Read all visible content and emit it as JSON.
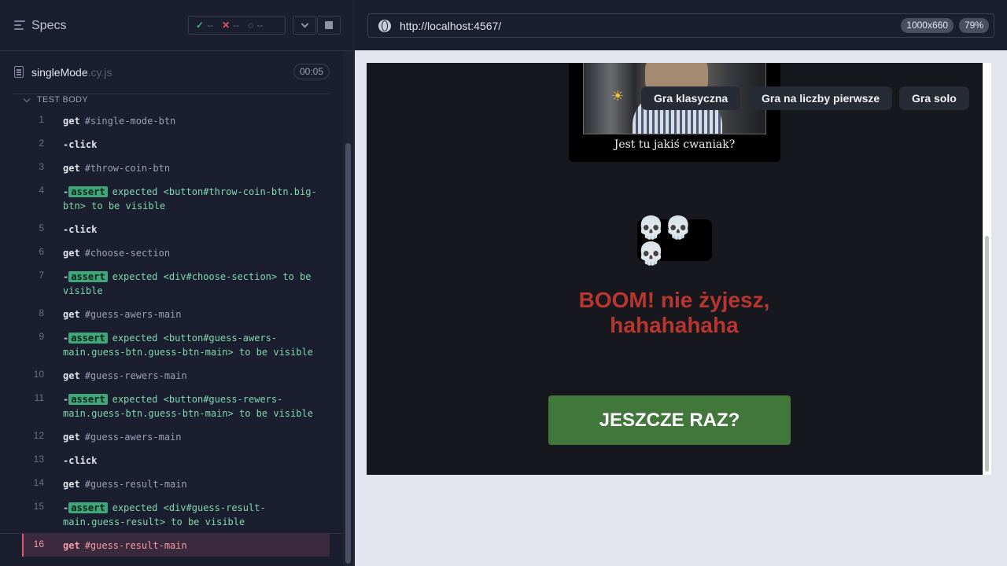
{
  "runner": {
    "specs_title": "Specs",
    "stats": {
      "passed": "--",
      "failed": "--",
      "pending": "--"
    },
    "file": {
      "name": "singleMode",
      "ext": ".cy.js",
      "timer": "00:05"
    },
    "section_label": "TEST BODY",
    "commands": [
      {
        "num": "1",
        "name": "get",
        "selector": "#single-mode-btn"
      },
      {
        "num": "2",
        "name": "-click",
        "selector": ""
      },
      {
        "num": "3",
        "name": "get",
        "selector": "#throw-coin-btn"
      },
      {
        "num": "4",
        "assert": "expected",
        "subject": "<button#throw-coin-btn.big-btn>",
        "to_be": "to be",
        "state": "visible"
      },
      {
        "num": "5",
        "name": "-click",
        "selector": ""
      },
      {
        "num": "6",
        "name": "get",
        "selector": "#choose-section"
      },
      {
        "num": "7",
        "assert": "expected",
        "subject": "<div#choose-section>",
        "to_be": "to be",
        "state": "visible"
      },
      {
        "num": "8",
        "name": "get",
        "selector": "#guess-awers-main"
      },
      {
        "num": "9",
        "assert": "expected",
        "subject": "<button#guess-awers-main.guess-btn.guess-btn-main>",
        "to_be": "to be",
        "state": "visible"
      },
      {
        "num": "10",
        "name": "get",
        "selector": "#guess-rewers-main"
      },
      {
        "num": "11",
        "assert": "expected",
        "subject": "<button#guess-rewers-main.guess-btn.guess-btn-main>",
        "to_be": "to be",
        "state": "visible"
      },
      {
        "num": "12",
        "name": "get",
        "selector": "#guess-awers-main"
      },
      {
        "num": "13",
        "name": "-click",
        "selector": ""
      },
      {
        "num": "14",
        "name": "get",
        "selector": "#guess-result-main"
      },
      {
        "num": "15",
        "assert": "expected",
        "subject": "<div#guess-result-main.guess-result>",
        "to_be": "to be",
        "state": "visible"
      },
      {
        "num": "16",
        "name": "get",
        "selector": "#guess-result-main",
        "active": true
      }
    ],
    "assert_label": "assert"
  },
  "browser": {
    "url": "http://localhost:4567/",
    "viewport": "1000x660",
    "zoom": "79%"
  },
  "app": {
    "meme_caption": "Jest tu jakiś cwaniak?",
    "nav": [
      "Gra klasyczna",
      "Gra na liczby pierwsze",
      "Gra solo"
    ],
    "coin_glyphs": "💀💀💀",
    "result_text": "BOOM! nie żyjesz, hahahahaha",
    "again_button": "JESZCZE RAZ?"
  },
  "colors": {
    "pass": "#3fb27f",
    "fail": "#e45770",
    "result": "#b8362f",
    "again_bg": "#41773b"
  }
}
